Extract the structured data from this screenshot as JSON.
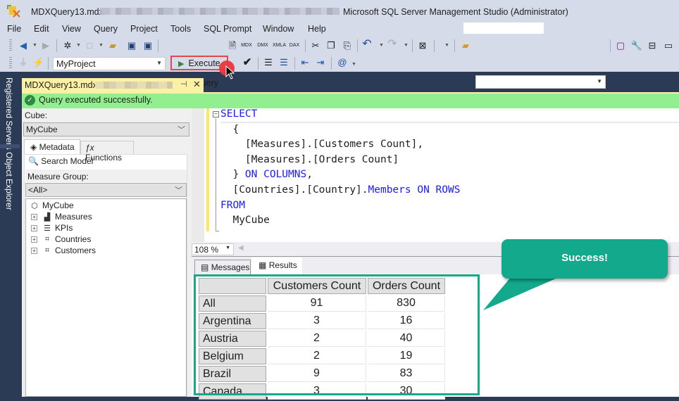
{
  "window": {
    "file_name": "MDXQuery13.mdx",
    "app_title": "Microsoft SQL Server Management Studio (Administrator)"
  },
  "menu": [
    "File",
    "Edit",
    "View",
    "Query",
    "Project",
    "Tools",
    "SQL Prompt",
    "Window",
    "Help"
  ],
  "toolbar": {
    "new_query_label": "New Query",
    "query_types": [
      "MDX",
      "DMX",
      "XMLA",
      "DAX"
    ],
    "project_combo_value": "MyProject",
    "execute_label": "Execute",
    "search_combo_value": ""
  },
  "left_rail": {
    "registered_servers": "Registered Servers",
    "object_explorer": "Object Explorer"
  },
  "document_tab": {
    "name": "MDXQuery13.mdx",
    "pin_icon": "⊣",
    "close_icon": "✕"
  },
  "status": {
    "message": "Query executed successfully.",
    "color": "#92ef8f"
  },
  "metadata_panel": {
    "cube_label": "Cube:",
    "cube_value": "MyCube",
    "tabs": [
      "Metadata",
      "Functions"
    ],
    "search_model": "Search Model",
    "measure_group_label": "Measure Group:",
    "measure_group_value": "<All>",
    "tree": {
      "root": "MyCube",
      "children": [
        "Measures",
        "KPIs",
        "Countries",
        "Customers"
      ]
    }
  },
  "editor": {
    "lines": [
      {
        "segments": [
          {
            "t": "SELECT",
            "kw": true
          }
        ]
      },
      {
        "segments": [
          {
            "t": "  {",
            "kw": false
          }
        ]
      },
      {
        "segments": [
          {
            "t": "    [Measures].[Customers Count],",
            "kw": false
          }
        ]
      },
      {
        "segments": [
          {
            "t": "    [Measures].[Orders Count]",
            "kw": false
          }
        ]
      },
      {
        "segments": [
          {
            "t": "  } ",
            "kw": false
          },
          {
            "t": "ON COLUMNS",
            "kw": true
          },
          {
            "t": ",",
            "kw": false
          }
        ]
      },
      {
        "segments": [
          {
            "t": "  [Countries].[Country].",
            "kw": false
          },
          {
            "t": "Members ON ROWS",
            "kw": true
          }
        ]
      },
      {
        "segments": [
          {
            "t": "FROM",
            "kw": true
          }
        ]
      },
      {
        "segments": [
          {
            "t": "  MyCube",
            "kw": false
          }
        ]
      }
    ],
    "zoom_level": "108 %"
  },
  "results": {
    "tabs": [
      "Messages",
      "Results"
    ],
    "active_tab": "Results",
    "columns": [
      "",
      "Customers Count",
      "Orders Count"
    ],
    "rows": [
      {
        "label": "All",
        "customers_count": "91",
        "orders_count": "830"
      },
      {
        "label": "Argentina",
        "customers_count": "3",
        "orders_count": "16"
      },
      {
        "label": "Austria",
        "customers_count": "2",
        "orders_count": "40"
      },
      {
        "label": "Belgium",
        "customers_count": "2",
        "orders_count": "19"
      },
      {
        "label": "Brazil",
        "customers_count": "9",
        "orders_count": "83"
      },
      {
        "label": "Canada",
        "customers_count": "3",
        "orders_count": "30"
      }
    ]
  },
  "callout": {
    "text": "Success!",
    "color": "#12a98c"
  },
  "colors": {
    "chrome": "#d6dbe9",
    "dark_rail": "#2b3a55",
    "highlight_border": "#e0494c",
    "keyword": "#1a1aff"
  }
}
